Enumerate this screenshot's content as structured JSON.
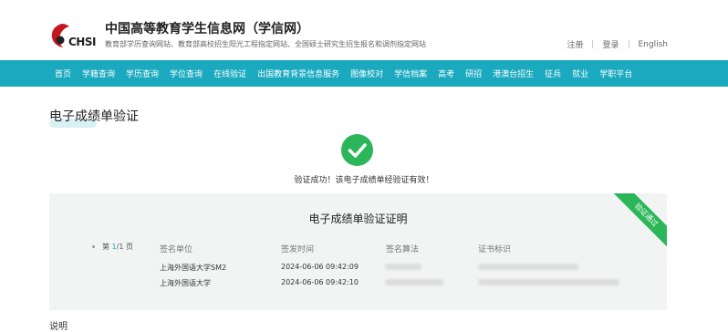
{
  "header": {
    "logo_text": "CHSI",
    "title": "中国高等教育学生信息网（学信网）",
    "subtitle": "教育部学历查询网站、教育部高校招生阳光工程指定网站、全国硕士研究生招生报名和调剂指定网站",
    "links": [
      "注册",
      "登录",
      "English"
    ]
  },
  "nav": {
    "items": [
      "首页",
      "学籍查询",
      "学历查询",
      "学位查询",
      "在线验证",
      "出国教育背景信息服务",
      "图像校对",
      "学信档案",
      "高考",
      "研招",
      "港澳台招生",
      "征兵",
      "就业",
      "学职平台"
    ]
  },
  "page": {
    "title": "电子成绩单验证",
    "success_message": "验证成功！该电子成绩单经验证有效！"
  },
  "card": {
    "title": "电子成绩单验证证明",
    "ribbon": "验证通过",
    "pager": {
      "prefix": "第 ",
      "current": "1",
      "suffix": "/1 页"
    },
    "headers": [
      "签名单位",
      "签发时间",
      "签名算法",
      "证书标识"
    ],
    "rows": [
      {
        "unit": "上海外国语大学SM2",
        "time": "2024-06-06 09:42:09"
      },
      {
        "unit": "上海外国语大学",
        "time": "2024-06-06 09:42:10"
      }
    ]
  },
  "explain_label": "说明",
  "colors": {
    "accent": "#1aa9be",
    "success": "#2cb65a"
  }
}
